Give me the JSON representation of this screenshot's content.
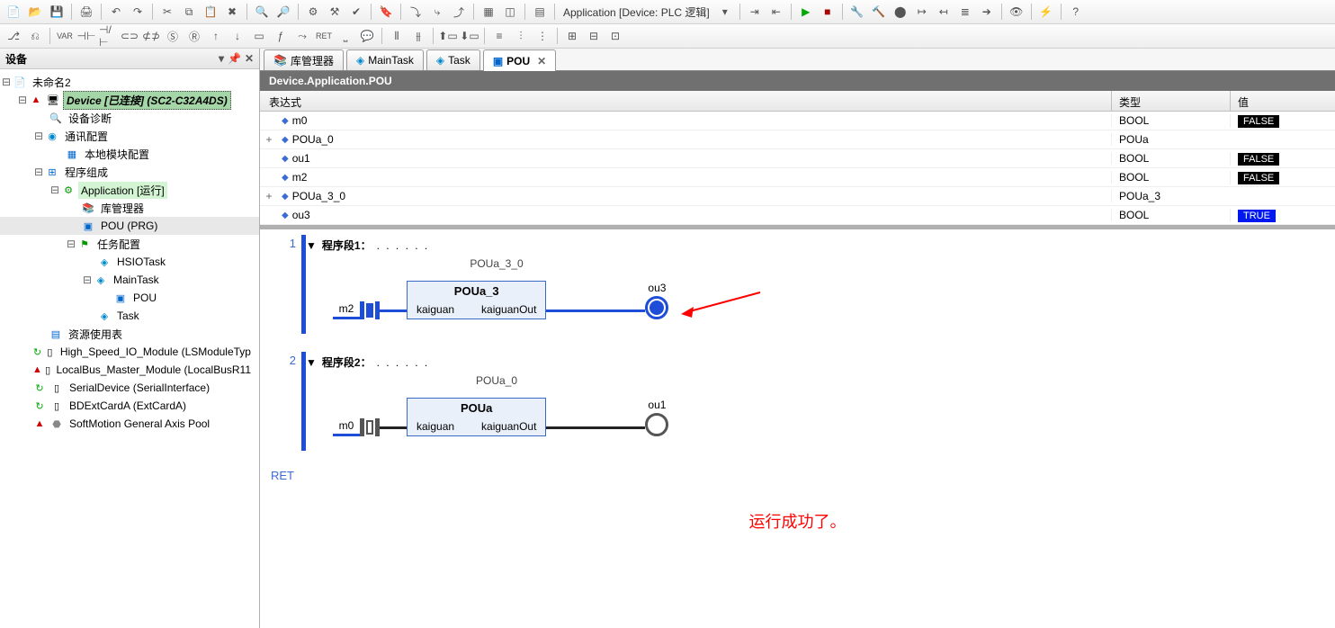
{
  "toolbar": {
    "app_context": "Application [Device: PLC 逻辑]"
  },
  "left_pane": {
    "title": "设备",
    "tree": {
      "root": "未命名2",
      "device": "Device [已连接] (SC2-C32A4DS)",
      "diag": "设备诊断",
      "comm": "通讯配置",
      "local_module": "本地模块配置",
      "prog_group": "程序组成",
      "app": "Application [运行]",
      "lib_mgr": "库管理器",
      "pou": "POU (PRG)",
      "task_cfg": "任务配置",
      "hsio": "HSIOTask",
      "maintask": "MainTask",
      "task_pou": "POU",
      "task": "Task",
      "resources": "资源使用表",
      "hs_io": "High_Speed_IO_Module (LSModuleTyp",
      "localbus": "LocalBus_Master_Module (LocalBusR11",
      "serial": "SerialDevice (SerialInterface)",
      "bdext": "BDExtCardA (ExtCardA)",
      "softmotion": "SoftMotion General Axis Pool"
    }
  },
  "tabs": {
    "t1": "库管理器",
    "t2": "MainTask",
    "t3": "Task",
    "t4": "POU"
  },
  "breadcrumb": "Device.Application.POU",
  "var_headers": {
    "expr": "表达式",
    "type": "类型",
    "val": "值"
  },
  "vars": [
    {
      "name": "m0",
      "type": "BOOL",
      "val": "FALSE",
      "badge": "false",
      "exp": ""
    },
    {
      "name": "POUa_0",
      "type": "POUa",
      "val": "",
      "badge": "",
      "exp": "+"
    },
    {
      "name": "ou1",
      "type": "BOOL",
      "val": "FALSE",
      "badge": "false",
      "exp": ""
    },
    {
      "name": "m2",
      "type": "BOOL",
      "val": "FALSE",
      "badge": "false",
      "exp": ""
    },
    {
      "name": "POUa_3_0",
      "type": "POUa_3",
      "val": "",
      "badge": "",
      "exp": "+"
    },
    {
      "name": "ou3",
      "type": "BOOL",
      "val": "TRUE",
      "badge": "true",
      "exp": ""
    }
  ],
  "rung1": {
    "num": "1",
    "title": "程序段1：",
    "dots": ". . . . . .",
    "instance": "POUa_3_0",
    "fb_title": "POUa_3",
    "in_var": "m2",
    "in_port": "kaiguan",
    "out_port": "kaiguanOut",
    "out_var": "ou3"
  },
  "rung2": {
    "num": "2",
    "title": "程序段2：",
    "dots": ". . . . . .",
    "instance": "POUa_0",
    "fb_title": "POUa",
    "in_var": "m0",
    "in_port": "kaiguan",
    "out_port": "kaiguanOut",
    "out_var": "ou1"
  },
  "ret": "RET",
  "success": "运行成功了。"
}
